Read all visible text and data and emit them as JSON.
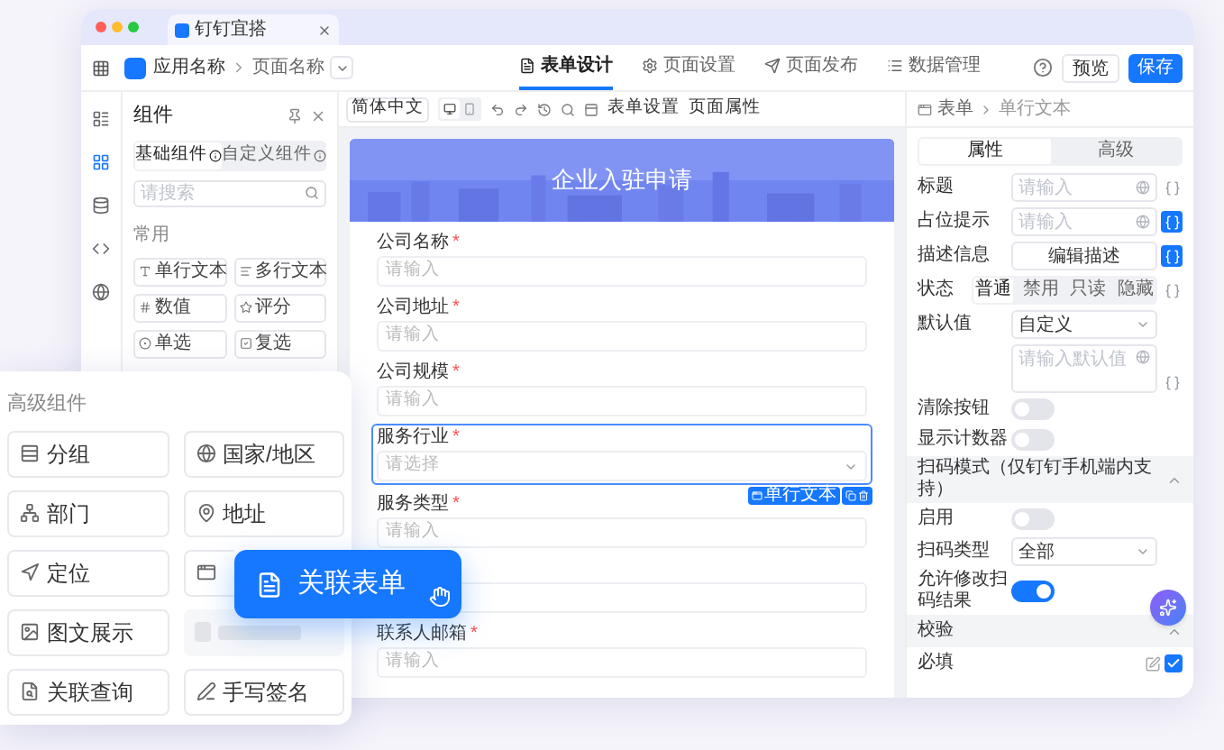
{
  "browser_tab": {
    "title": "钉钉宜搭"
  },
  "header": {
    "app_name": "应用名称",
    "page_name": "页面名称",
    "tabs": [
      {
        "label": "表单设计",
        "selected": true
      },
      {
        "label": "页面设置",
        "selected": false
      },
      {
        "label": "页面发布",
        "selected": false
      },
      {
        "label": "数据管理",
        "selected": false
      }
    ],
    "preview": "预览",
    "save": "保存"
  },
  "rail": [
    {
      "selected": false
    },
    {
      "selected": true
    },
    {
      "selected": false
    },
    {
      "selected": false
    },
    {
      "selected": false
    }
  ],
  "components": {
    "title": "组件",
    "tabs": [
      {
        "label": "基础组件",
        "selected": true
      },
      {
        "label": "自定义组件",
        "selected": false
      }
    ],
    "search_placeholder": "请搜索",
    "section": "常用",
    "items": [
      "单行文本",
      "多行文本",
      "数值",
      "评分",
      "单选",
      "复选"
    ]
  },
  "canvas_toolbar": {
    "language": "简体中文",
    "view": [
      {
        "selected": true
      },
      {
        "selected": false
      }
    ],
    "form_settings": "表单设置",
    "page_props": "页面属性"
  },
  "form": {
    "title": "企业入驻申请",
    "required_mark": "*",
    "selected_badge": "单行文本",
    "fields": [
      {
        "kind": "input",
        "label": "公司名称",
        "required": true,
        "placeholder": "请输入",
        "selected": false
      },
      {
        "kind": "input",
        "label": "公司地址",
        "required": true,
        "placeholder": "请输入",
        "selected": false
      },
      {
        "kind": "input",
        "label": "公司规模",
        "required": true,
        "placeholder": "请输入",
        "selected": false
      },
      {
        "kind": "select",
        "label": "服务行业",
        "required": true,
        "placeholder": "请选择",
        "selected": true
      },
      {
        "kind": "input",
        "label": "服务类型",
        "required": true,
        "placeholder": "请输入",
        "selected": false
      },
      {
        "kind": "input",
        "selected": false
      },
      {
        "kind": "input",
        "label": "联系人邮箱",
        "required": true,
        "placeholder": "请输入",
        "selected": false
      }
    ]
  },
  "properties": {
    "breadcrumb": [
      "表单",
      "单行文本"
    ],
    "tabs": [
      {
        "label": "属性",
        "selected": true
      },
      {
        "label": "高级",
        "selected": false
      }
    ],
    "rows": [
      {
        "kind": "input",
        "label": "标题",
        "placeholder": "请输入",
        "variable_active": false
      },
      {
        "kind": "input",
        "label": "占位提示",
        "placeholder": "请输入",
        "variable_active": true
      },
      {
        "kind": "button",
        "label": "描述信息",
        "button": "编辑描述",
        "variable_active": true
      },
      {
        "kind": "segmented",
        "label": "状态",
        "options": [
          {
            "label": "普通",
            "selected": true
          },
          {
            "label": "禁用",
            "selected": false
          },
          {
            "label": "只读",
            "selected": false
          },
          {
            "label": "隐藏",
            "selected": false
          }
        ],
        "variable_active": false
      },
      {
        "kind": "select",
        "label": "默认值",
        "value": "自定义"
      },
      {
        "kind": "textarea",
        "placeholder": "请输入默认值",
        "variable_active": false
      },
      {
        "kind": "toggle",
        "label": "清除按钮",
        "on": false
      },
      {
        "kind": "toggle",
        "label": "显示计数器",
        "on": false
      },
      {
        "kind": "section",
        "label": "扫码模式（仅钉钉手机端内支持）",
        "expanded": true
      },
      {
        "kind": "toggle",
        "label": "启用",
        "on": false
      },
      {
        "kind": "select",
        "label": "扫码类型",
        "value": "全部"
      },
      {
        "kind": "toggle",
        "label": "允许修改扫码结果",
        "on": true
      },
      {
        "kind": "section",
        "label": "校验",
        "expanded": true
      },
      {
        "kind": "checkbox",
        "label": "必填",
        "checked": true
      }
    ]
  },
  "advanced_panel": {
    "title": "高级组件",
    "items": [
      {
        "kind": "normal",
        "label": "分组"
      },
      {
        "kind": "normal",
        "label": "国家/地区"
      },
      {
        "kind": "normal",
        "label": "部门"
      },
      {
        "kind": "normal",
        "label": "地址"
      },
      {
        "kind": "normal",
        "label": "定位"
      },
      {
        "kind": "covered"
      },
      {
        "kind": "normal",
        "label": "图文展示"
      },
      {
        "kind": "ghost"
      },
      {
        "kind": "normal",
        "label": "关联查询"
      },
      {
        "kind": "normal",
        "label": "手写签名"
      }
    ]
  },
  "drag_chip": {
    "label": "关联表单"
  }
}
